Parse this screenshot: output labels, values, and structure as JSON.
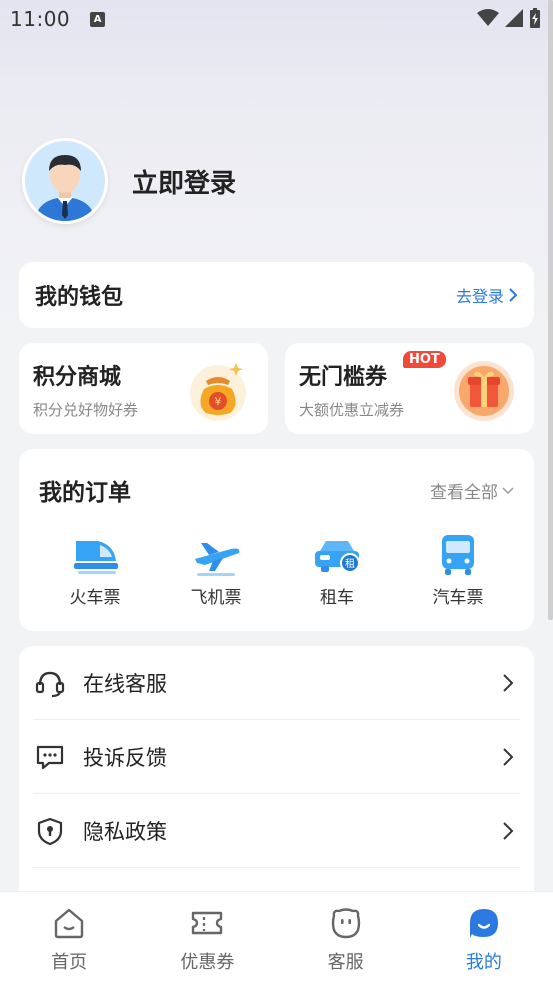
{
  "status_bar": {
    "time": "11:00",
    "notification_glyph": "A"
  },
  "profile": {
    "login_label": "立即登录"
  },
  "wallet": {
    "title": "我的钱包",
    "link_label": "去登录"
  },
  "promos": [
    {
      "title": "积分商城",
      "subtitle": "积分兑好物好券",
      "icon": "money-bag-icon"
    },
    {
      "title": "无门槛券",
      "subtitle": "大额优惠立减券",
      "badge": "HOT",
      "icon": "gift-box-icon"
    }
  ],
  "orders": {
    "title": "我的订单",
    "view_all": "查看全部",
    "items": [
      {
        "label": "火车票",
        "icon": "train-icon"
      },
      {
        "label": "飞机票",
        "icon": "plane-icon"
      },
      {
        "label": "租车",
        "icon": "rental-car-icon"
      },
      {
        "label": "汽车票",
        "icon": "bus-icon"
      }
    ]
  },
  "menu": [
    {
      "label": "在线客服",
      "icon": "headset-icon"
    },
    {
      "label": "投诉反馈",
      "icon": "feedback-chat-icon"
    },
    {
      "label": "隐私政策",
      "icon": "shield-icon"
    }
  ],
  "tabs": [
    {
      "label": "首页",
      "icon": "home-icon",
      "active": false
    },
    {
      "label": "优惠券",
      "icon": "ticket-icon",
      "active": false
    },
    {
      "label": "客服",
      "icon": "service-face-icon",
      "active": false
    },
    {
      "label": "我的",
      "icon": "profile-face-icon",
      "active": true
    }
  ],
  "colors": {
    "accent": "#2a7ae2",
    "hot": "#f04a3b",
    "background": "#f2f3f5"
  }
}
